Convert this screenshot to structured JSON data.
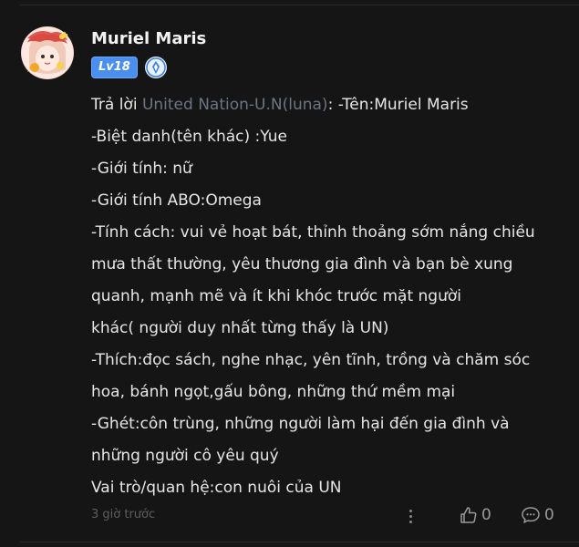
{
  "post": {
    "author": "Muriel Maris",
    "level": "Lv18",
    "reply_prefix": "Trả lời ",
    "mention": "United Nation-U.N(luna)",
    "mention_suffix": ": -Tên:Muriel Maris",
    "lines": [
      "-Biệt danh(tên khác) :Yue",
      "-Giới tính: nữ",
      "-Giới tính ABO:Omega",
      "-Tính cách: vui vẻ hoạt bát, thỉnh thoảng sớm nắng chiều",
      "mưa thất thường, yêu thương gia đình và bạn bè xung",
      "quanh, mạnh mẽ và ít khi khóc trước mặt người",
      "khác( người duy nhất từng thấy là UN)",
      "-Thích:đọc sách, nghe nhạc, yên tĩnh, trồng và chăm sóc",
      "hoa, bánh ngọt,gấu bông, những thứ mềm mại",
      "-Ghét:côn trùng, những người làm hại đến gia đình và",
      "những người cô yêu quý",
      "Vai trò/quan hệ:con nuôi của UN"
    ],
    "timestamp": "3 giờ trước",
    "like_count": "0",
    "comment_count": "0"
  },
  "icons": {
    "avatar": "avatar-image",
    "champion": "champion-badge-icon",
    "more": "more-vertical-icon",
    "like": "thumbs-up-icon",
    "comment": "comment-icon"
  },
  "colors": {
    "background": "#151515",
    "level_badge": "#4a8ef0",
    "mention": "#6b7684"
  }
}
